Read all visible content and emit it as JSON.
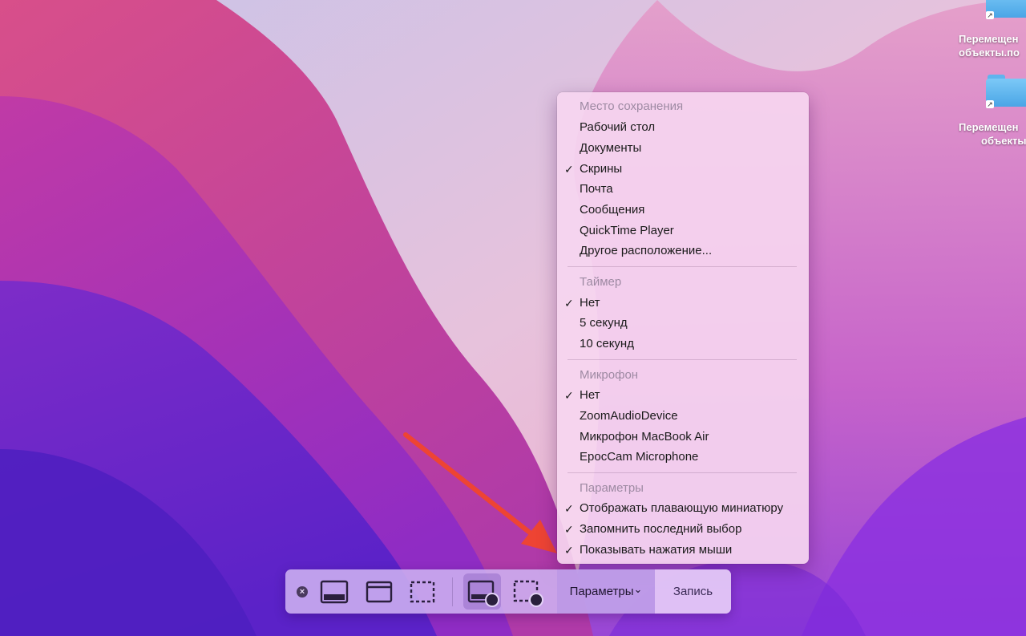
{
  "desktop": {
    "icons": [
      {
        "label": "Перемещен",
        "label2": "объекты.по"
      },
      {
        "label": "Перемещен",
        "label2": "объекты"
      }
    ]
  },
  "menu": {
    "sections": [
      {
        "header": "Место сохранения",
        "items": [
          {
            "label": "Рабочий стол",
            "checked": false
          },
          {
            "label": "Документы",
            "checked": false
          },
          {
            "label": "Скрины",
            "checked": true
          },
          {
            "label": "Почта",
            "checked": false
          },
          {
            "label": "Сообщения",
            "checked": false
          },
          {
            "label": "QuickTime Player",
            "checked": false
          },
          {
            "label": "Другое расположение...",
            "checked": false
          }
        ]
      },
      {
        "header": "Таймер",
        "items": [
          {
            "label": "Нет",
            "checked": true
          },
          {
            "label": "5 секунд",
            "checked": false
          },
          {
            "label": "10 секунд",
            "checked": false
          }
        ]
      },
      {
        "header": "Микрофон",
        "items": [
          {
            "label": "Нет",
            "checked": true
          },
          {
            "label": "ZoomAudioDevice",
            "checked": false
          },
          {
            "label": "Микрофон MacBook Air",
            "checked": false
          },
          {
            "label": "EpocCam Microphone",
            "checked": false
          }
        ]
      },
      {
        "header": "Параметры",
        "items": [
          {
            "label": "Отображать плавающую миниатюру",
            "checked": true
          },
          {
            "label": "Запомнить последний выбор",
            "checked": true
          },
          {
            "label": "Показывать нажатия мыши",
            "checked": true
          }
        ]
      }
    ],
    "check_glyph": "✓"
  },
  "toolbar": {
    "close_glyph": "×",
    "options_label": "Параметры",
    "options_chevron": "⌄",
    "record_label": "Запись"
  },
  "colors": {
    "arrow": "#ee4433",
    "menu_bg": "#f6d6f0",
    "toolbar_bg": "#cdb0f0"
  }
}
